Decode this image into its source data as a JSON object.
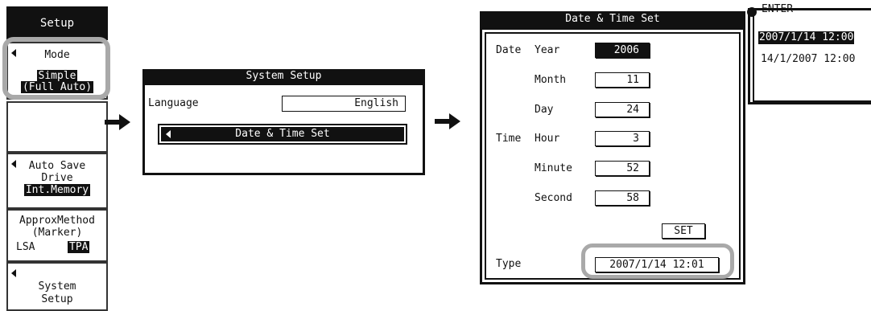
{
  "menu": {
    "title": "Setup",
    "mode_label": "Mode",
    "mode_value_line1": "Simple",
    "mode_value_line2": "(Full Auto)",
    "autosave_line1": "Auto Save",
    "autosave_line2": "Drive",
    "autosave_value": "Int.Memory",
    "approx_line1": "ApproxMethod",
    "approx_line2": "(Marker)",
    "approx_opt1": "LSA",
    "approx_opt2": "TPA",
    "system_line1": "System",
    "system_line2": "Setup"
  },
  "system_setup": {
    "title": "System Setup",
    "language_label": "Language",
    "language_value": "English",
    "date_time_item": "Date & Time Set"
  },
  "date_time": {
    "title": "Date & Time Set",
    "date_label": "Date",
    "time_label": "Time",
    "year_label": "Year",
    "year_value": "2006",
    "month_label": "Month",
    "month_value": "11",
    "day_label": "Day",
    "day_value": "24",
    "hour_label": "Hour",
    "hour_value": "3",
    "minute_label": "Minute",
    "minute_value": "52",
    "second_label": "Second",
    "second_value": "58",
    "set_label": "SET",
    "type_label": "Type",
    "type_value": "2007/1/14 12:01"
  },
  "enter_popup": {
    "title": "ENTER",
    "options": [
      "2007/1/14 12:00",
      "14/1/2007 12:00"
    ]
  }
}
